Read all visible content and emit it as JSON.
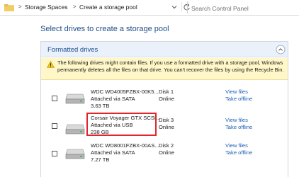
{
  "breadcrumb": {
    "items": [
      "Storage Spaces",
      "Create a storage pool"
    ],
    "separator": ">"
  },
  "search": {
    "placeholder": "Search Control Panel"
  },
  "page_title": "Select drives to create a storage pool",
  "panel": {
    "title": "Formatted drives",
    "warning": "The following drives might contain files. If you use a formatted drive with a storage pool, Windows permanently deletes all the files on that drive. You can't recover the files by using the Recycle Bin."
  },
  "drives": [
    {
      "name": "WDC WD4005FZBX-00K5...",
      "connection": "Attached via SATA",
      "size": "3.63 TB",
      "disk": "Disk 1",
      "status": "Online",
      "view_label": "View files",
      "offline_label": "Take offline",
      "checked": false
    },
    {
      "name": "Corsair Voyager GTX SCSI...",
      "connection": "Attached via USB",
      "size": "238 GB",
      "disk": "Disk 3",
      "status": "Online",
      "view_label": "View files",
      "offline_label": "Take offline",
      "checked": false
    },
    {
      "name": "WDC WD8001FZBX-00AS...",
      "connection": "Attached via SATA",
      "size": "7.27 TB",
      "disk": "Disk 2",
      "status": "Online",
      "view_label": "View files",
      "offline_label": "Take offline",
      "checked": false
    }
  ],
  "colors": {
    "accent": "#1e4e8c",
    "link": "#1a5fb4",
    "warning_bg": "#fff7c8",
    "highlight": "#e0262b"
  }
}
